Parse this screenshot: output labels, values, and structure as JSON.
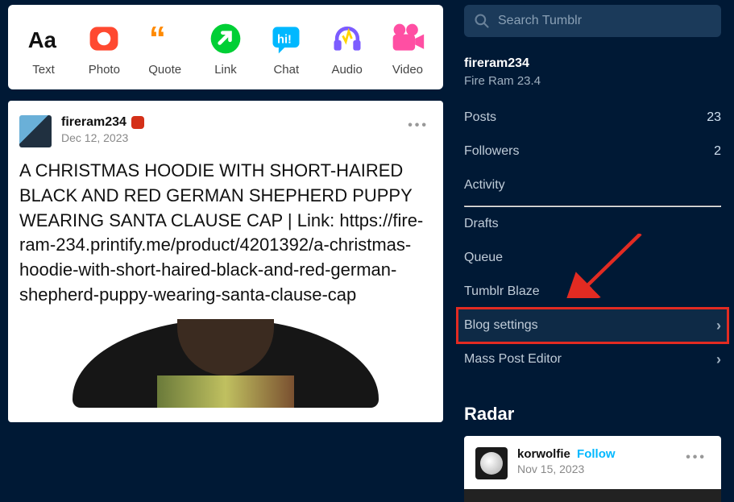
{
  "search": {
    "placeholder": "Search Tumblr"
  },
  "compose": [
    {
      "key": "text",
      "label": "Text"
    },
    {
      "key": "photo",
      "label": "Photo"
    },
    {
      "key": "quote",
      "label": "Quote"
    },
    {
      "key": "link",
      "label": "Link"
    },
    {
      "key": "chat",
      "label": "Chat"
    },
    {
      "key": "audio",
      "label": "Audio"
    },
    {
      "key": "video",
      "label": "Video"
    }
  ],
  "post": {
    "username": "fireram234",
    "date": "Dec 12, 2023",
    "body": "A CHRISTMAS HOODIE WITH SHORT-HAIRED BLACK AND RED GERMAN SHEPHERD PUPPY WEARING SANTA CLAUSE CAP | Link: https://fire-ram-234.printify.me/product/4201392/a-christmas-hoodie-with-short-haired-black-and-red-german-shepherd-puppy-wearing-santa-clause-cap"
  },
  "blog": {
    "name": "fireram234",
    "title": "Fire Ram 23.4"
  },
  "menu": {
    "posts": {
      "label": "Posts",
      "count": "23"
    },
    "followers": {
      "label": "Followers",
      "count": "2"
    },
    "activity": {
      "label": "Activity"
    },
    "drafts": {
      "label": "Drafts"
    },
    "queue": {
      "label": "Queue"
    },
    "blaze": {
      "label": "Tumblr Blaze"
    },
    "settings": {
      "label": "Blog settings"
    },
    "masspost": {
      "label": "Mass Post Editor"
    }
  },
  "radar": {
    "heading": "Radar",
    "username": "korwolfie",
    "follow_label": "Follow",
    "date": "Nov 15, 2023"
  }
}
